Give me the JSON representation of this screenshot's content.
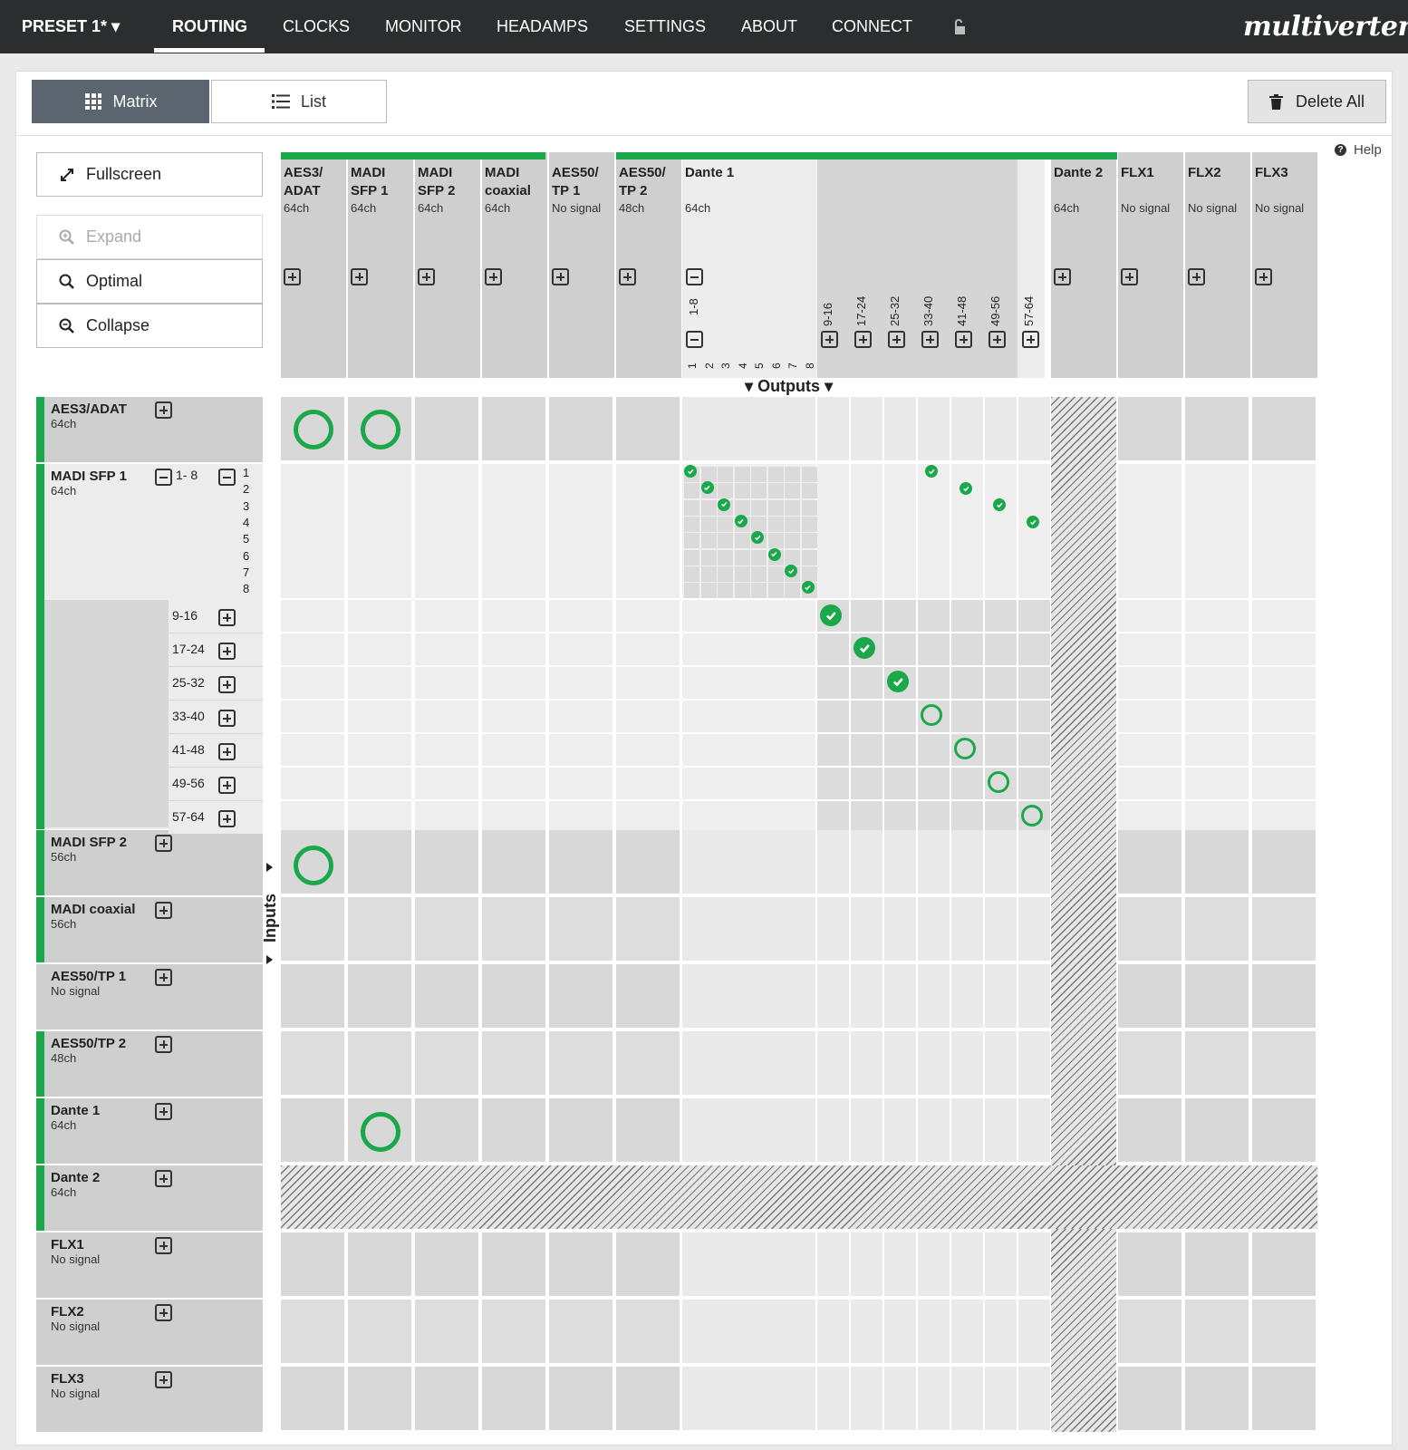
{
  "nav": {
    "preset": "PRESET 1*",
    "items": [
      "ROUTING",
      "CLOCKS",
      "MONITOR",
      "HEADAMPS",
      "SETTINGS",
      "ABOUT",
      "CONNECT"
    ],
    "active": "ROUTING",
    "logo": "multiverter"
  },
  "toolbar": {
    "matrix_label": "Matrix",
    "list_label": "List",
    "delete_all_label": "Delete All",
    "help_label": "Help"
  },
  "sidebar": {
    "fullscreen": "Fullscreen",
    "expand": "Expand",
    "optimal": "Optimal",
    "collapse": "Collapse"
  },
  "outputs_label": "Outputs",
  "inputs_label": "Inputs",
  "columns": [
    {
      "name": "AES3/\nADAT",
      "sub": "64ch"
    },
    {
      "name": "MADI\nSFP 1",
      "sub": "64ch"
    },
    {
      "name": "MADI\nSFP 2",
      "sub": "64ch"
    },
    {
      "name": "MADI\ncoaxial",
      "sub": "64ch"
    },
    {
      "name": "AES50/\nTP 1",
      "sub": "No signal"
    },
    {
      "name": "AES50/\nTP 2",
      "sub": "48ch"
    },
    {
      "name": "Dante 1",
      "sub": "64ch"
    },
    {
      "name": "Dante 2",
      "sub": "64ch"
    },
    {
      "name": "FLX1",
      "sub": "No signal"
    },
    {
      "name": "FLX2",
      "sub": "No signal"
    },
    {
      "name": "FLX3",
      "sub": "No signal"
    }
  ],
  "dante1_groups": [
    "1-8",
    "9-16",
    "17-24",
    "25-32",
    "33-40",
    "41-48",
    "49-56",
    "57-64"
  ],
  "dante1_channels": [
    "1",
    "2",
    "3",
    "4",
    "5",
    "6",
    "7",
    "8"
  ],
  "rows": [
    {
      "name": "AES3/ADAT",
      "sub": "64ch"
    },
    {
      "name": "MADI SFP 1",
      "sub": "64ch"
    },
    {
      "name": "MADI SFP 2",
      "sub": "56ch"
    },
    {
      "name": "MADI coaxial",
      "sub": "56ch"
    },
    {
      "name": "AES50/TP 1",
      "sub": "No signal"
    },
    {
      "name": "AES50/TP 2",
      "sub": "48ch"
    },
    {
      "name": "Dante 1",
      "sub": "64ch"
    },
    {
      "name": "Dante 2",
      "sub": "64ch"
    },
    {
      "name": "FLX1",
      "sub": "No signal"
    },
    {
      "name": "FLX2",
      "sub": "No signal"
    },
    {
      "name": "FLX3",
      "sub": "No signal"
    }
  ],
  "madi_sfp1_groups": [
    "1- 8",
    "9-16",
    "17-24",
    "25-32",
    "33-40",
    "41-48",
    "49-56",
    "57-64"
  ],
  "madi_sfp1_channels": [
    "1",
    "2",
    "3",
    "4",
    "5",
    "6",
    "7",
    "8"
  ],
  "colors": {
    "accent": "#1aa84a",
    "nav_bg": "#2b2d2f",
    "active_view": "#5a6570"
  }
}
